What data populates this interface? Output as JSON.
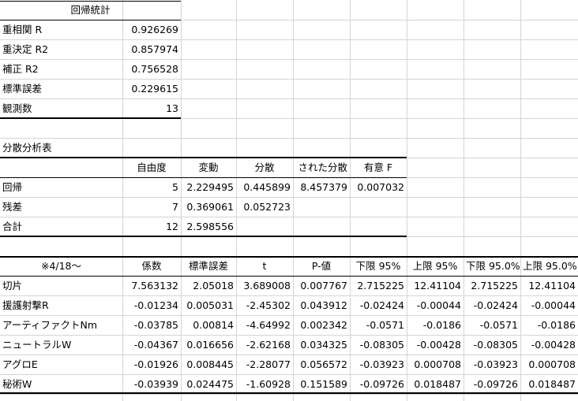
{
  "regression_stats": {
    "header": "回帰統計",
    "rows": [
      {
        "label": "重相関 R",
        "value": "0.926269"
      },
      {
        "label": "重決定 R2",
        "value": "0.857974"
      },
      {
        "label": "補正 R2",
        "value": "0.756528"
      },
      {
        "label": "標準誤差",
        "value": "0.229615"
      },
      {
        "label": "観測数",
        "value": "13"
      }
    ]
  },
  "anova": {
    "title": "分散分析表",
    "headers": [
      "自由度",
      "変動",
      "分散",
      "された分散",
      "有意 F"
    ],
    "rows": [
      {
        "label": "回帰",
        "values": [
          "5",
          "2.229495",
          "0.445899",
          "8.457379",
          "0.007032"
        ]
      },
      {
        "label": "残差",
        "values": [
          "7",
          "0.369061",
          "0.052723",
          "",
          ""
        ]
      },
      {
        "label": "合計",
        "values": [
          "12",
          "2.598556",
          "",
          "",
          ""
        ]
      }
    ]
  },
  "coefficients": {
    "headers": [
      "※4/18〜",
      "係数",
      "標準誤差",
      "t",
      "P-値",
      "下限 95%",
      "上限 95%",
      "下限 95.0%",
      "上限 95.0%"
    ],
    "rows": [
      {
        "label": "切片",
        "values": [
          "7.563132",
          "2.05018",
          "3.689008",
          "0.007767",
          "2.715225",
          "12.41104",
          "2.715225",
          "12.41104"
        ]
      },
      {
        "label": "援護射撃R",
        "values": [
          "-0.01234",
          "0.005031",
          "-2.45302",
          "0.043912",
          "-0.02424",
          "-0.00044",
          "-0.02424",
          "-0.00044"
        ]
      },
      {
        "label": "アーティファクトNm",
        "values": [
          "-0.03785",
          "0.00814",
          "-4.64992",
          "0.002342",
          "-0.0571",
          "-0.0186",
          "-0.0571",
          "-0.0186"
        ]
      },
      {
        "label": "ニュートラルW",
        "values": [
          "-0.04367",
          "0.016656",
          "-2.62168",
          "0.034325",
          "-0.08305",
          "-0.00428",
          "-0.08305",
          "-0.00428"
        ]
      },
      {
        "label": "アグロE",
        "values": [
          "-0.01926",
          "0.008445",
          "-2.28077",
          "0.056572",
          "-0.03923",
          "0.000708",
          "-0.03923",
          "0.000708"
        ]
      },
      {
        "label": "秘術W",
        "values": [
          "-0.03939",
          "0.024475",
          "-1.60928",
          "0.151589",
          "-0.09726",
          "0.018487",
          "-0.09726",
          "0.018487"
        ]
      }
    ]
  }
}
